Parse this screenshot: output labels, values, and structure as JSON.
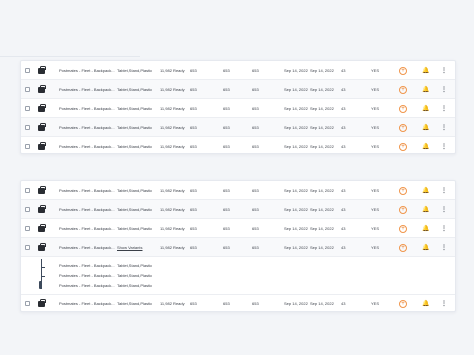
{
  "product_name": "Postmates - Fleet - Backpack...",
  "material": "Tablet,Stand,Plastic",
  "stock": "11,982 Ready",
  "value": "653",
  "date": "Sep 14, 2022",
  "count": "43",
  "yes": "YES",
  "show_variants": "Show Variants",
  "add_glyph": "+",
  "more_glyph": "⋮",
  "bell_glyph": "🔔",
  "icons": {
    "row_icon": "bag-icon",
    "add": "plus-circle-icon",
    "notify": "bell-icon",
    "menu": "vertical-dots-icon"
  },
  "colors": {
    "accent": "#e8812f",
    "background": "#f3f5f8",
    "card": "#ffffff"
  }
}
